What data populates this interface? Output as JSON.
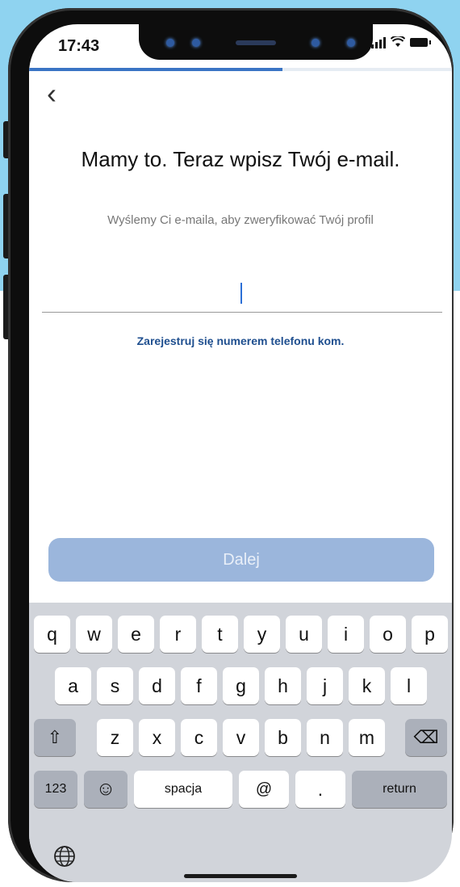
{
  "status_bar": {
    "time": "17:43"
  },
  "progress": {
    "fraction": 0.6
  },
  "back_glyph": "‹",
  "heading": {
    "title": "Mamy to. Teraz wpisz Twój e-mail.",
    "subtitle": "Wyślemy Ci e-maila, aby zweryfikować Twój profil"
  },
  "email_field": {
    "value": "",
    "placeholder": ""
  },
  "alt_link": "Zarejestruj się numerem telefonu kom.",
  "next_button": "Dalej",
  "keyboard": {
    "row1": [
      "q",
      "w",
      "e",
      "r",
      "t",
      "y",
      "u",
      "i",
      "o",
      "p"
    ],
    "row2": [
      "a",
      "s",
      "d",
      "f",
      "g",
      "h",
      "j",
      "k",
      "l"
    ],
    "row3": [
      "z",
      "x",
      "c",
      "v",
      "b",
      "n",
      "m"
    ],
    "shift": "⇧",
    "delete": "⌫",
    "numbers": "123",
    "emoji": "☺",
    "space": "spacja",
    "at": "@",
    "dot": ".",
    "return": "return"
  },
  "colors": {
    "accent": "#3a74c4",
    "button_disabled": "#9bb6dc",
    "link": "#1f4f8f"
  }
}
